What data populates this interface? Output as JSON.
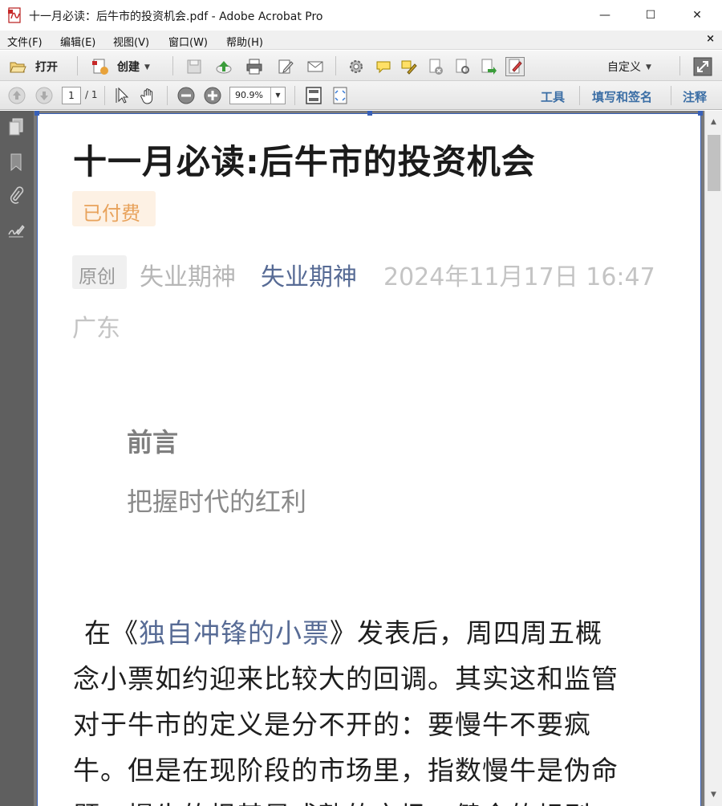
{
  "window": {
    "title": "十一月必读：后牛市的投资机会.pdf - Adobe Acrobat Pro",
    "minimize": "—",
    "maximize": "☐",
    "close": "✕"
  },
  "menu": {
    "items": [
      "文件(F)",
      "编辑(E)",
      "视图(V)",
      "窗口(W)",
      "帮助(H)"
    ],
    "close": "×"
  },
  "toolbar": {
    "open_label": "打开",
    "create_label": "创建",
    "custom_label": "自定义"
  },
  "nav": {
    "current_page": "1",
    "total_pages": "/ 1",
    "zoom": "90.9%",
    "tools_label": "工具",
    "fill_sign_label": "填写和签名",
    "comment_label": "注释"
  },
  "document": {
    "title": "十一月必读:后牛市的投资机会",
    "paid_badge": "已付费",
    "original_badge": "原创",
    "author": "失业期神",
    "account": "失业期神",
    "datetime": "2024年11月17日 16:47",
    "location": "广东",
    "preface_heading": "前言",
    "preface_subtitle": "把握时代的红利",
    "body": {
      "line1_pre": "在《",
      "line1_link": "独自冲锋的小票",
      "line1_post": "》发表后，周四周五概",
      "line2": "念小票如约迎来比较大的回调。其实这和监管",
      "line3": "对于牛市的定义是分不开的：要慢牛不要疯",
      "line4": "牛。但是在现阶段的市场里，指数慢牛是伪命",
      "line5": "题，慢牛的根基是成熟的市场，健全的规则"
    }
  },
  "colors": {
    "link": "#576b95",
    "paid": "#e8a25b",
    "panel_link": "#3b6ea5",
    "selection_border": "#3860b8"
  },
  "icons": [
    "pdf-app-icon",
    "folder-open-icon",
    "create-pdf-icon",
    "save-icon",
    "upload-icon",
    "print-icon",
    "edit-icon",
    "email-icon",
    "gear-icon",
    "comment-icon",
    "highlight-icon",
    "delete-page-icon",
    "extract-icon",
    "export-icon",
    "form-edit-icon",
    "expand-icon",
    "page-up-icon",
    "page-down-icon",
    "select-arrow-icon",
    "hand-icon",
    "zoom-out-icon",
    "zoom-in-icon",
    "fit-page-icon",
    "fit-width-icon",
    "pages-panel-icon",
    "bookmark-icon",
    "attachment-icon",
    "signature-icon"
  ]
}
